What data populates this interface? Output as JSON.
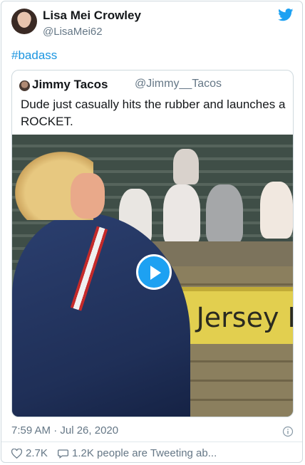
{
  "tweet": {
    "author_name": "Lisa Mei Crowley",
    "author_handle": "@LisaMei62",
    "text": "#badass",
    "timestamp": "7:59 AM · Jul 26, 2020",
    "likes": "2.7K",
    "people_tweeting": "1.2K people are Tweeting ab..."
  },
  "quoted": {
    "author_name": "Jimmy Tacos",
    "author_handle": "@Jimmy__Tacos",
    "text": "Dude just casually hits the rubber and launches a ROCKET.",
    "media_sign_text": "y Jersey L"
  },
  "icons": {
    "brand": "twitter-bird-icon",
    "play": "play-icon",
    "info": "info-icon",
    "like": "heart-icon",
    "reply": "speech-bubble-icon"
  },
  "colors": {
    "accent": "#1da1f2",
    "link": "#1b95e0",
    "secondary_text": "#657786",
    "border": "#cfd9de"
  }
}
